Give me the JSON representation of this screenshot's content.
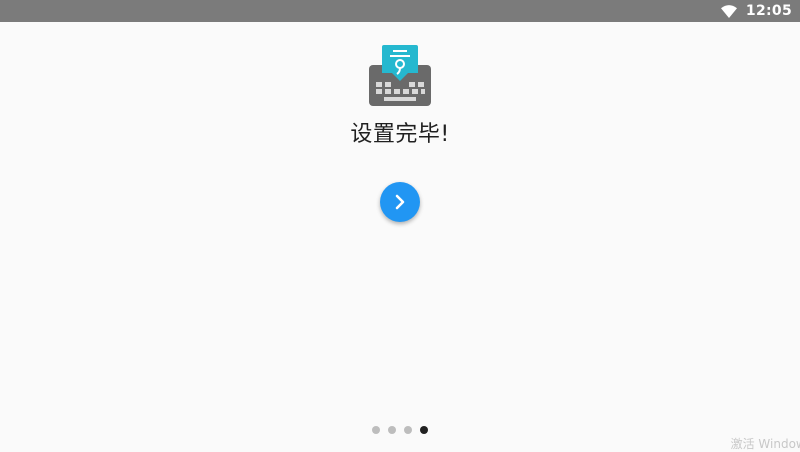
{
  "status_bar": {
    "time": "12:05",
    "wifi_icon": "wifi-icon"
  },
  "app_logo": {
    "icon": "keyboard-logo-icon",
    "badge_color": "#25b8cf",
    "keyboard_color": "#6a6a6a"
  },
  "main": {
    "title": "设置完毕!"
  },
  "next_button": {
    "icon": "chevron-right-icon",
    "color": "#2196f3"
  },
  "pager": {
    "count": 4,
    "active_index": 3
  },
  "watermark": {
    "text": "激活 Windows"
  }
}
